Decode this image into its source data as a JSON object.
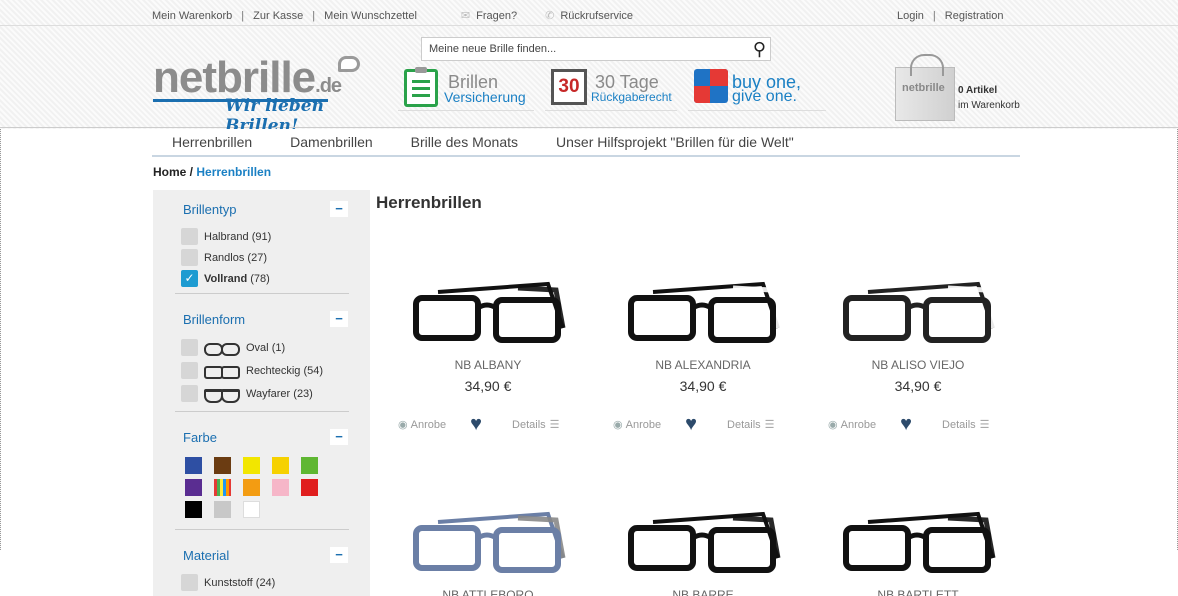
{
  "topbar": {
    "links": [
      "Mein Warenkorb",
      "Zur Kasse",
      "Mein Wunschzettel"
    ],
    "fragen": "Fragen?",
    "rueckruf": "Rückrufservice",
    "login": "Login",
    "registration": "Registration"
  },
  "logo": {
    "net": "net",
    "brille": "brille",
    "de": ".de",
    "tagline": "Wir lieben Brillen!"
  },
  "search": {
    "placeholder": "Meine neue Brille finden..."
  },
  "usps": [
    {
      "line1": "Brillen",
      "line2": "Versicherung"
    },
    {
      "badge": "30",
      "line1": "30 Tage",
      "line2": "Rückgaberecht"
    },
    {
      "line1": "buy one,",
      "line2": "give one."
    }
  ],
  "cart": {
    "bag_label": "netbrille",
    "count": "0 Artikel",
    "sub": "im Warenkorb"
  },
  "nav": [
    "Herrenbrillen",
    "Damenbrillen",
    "Brille des Monats",
    "Unser Hilfsprojekt \"Brillen für die Welt\""
  ],
  "breadcrumb": {
    "home": "Home",
    "sep": " / ",
    "current": "Herrenbrillen"
  },
  "filters": {
    "brillentyp": {
      "title": "Brillentyp",
      "items": [
        {
          "label": "Halbrand",
          "count": "(91)",
          "checked": false
        },
        {
          "label": "Randlos",
          "count": "(27)",
          "checked": false
        },
        {
          "label": "Vollrand",
          "count": "(78)",
          "checked": true
        }
      ]
    },
    "brillenform": {
      "title": "Brillenform",
      "items": [
        {
          "label": "Oval",
          "count": "(1)"
        },
        {
          "label": "Rechteckig",
          "count": "(54)"
        },
        {
          "label": "Wayfarer",
          "count": "(23)"
        }
      ]
    },
    "farbe": {
      "title": "Farbe",
      "colors": [
        "#2e4fa3",
        "#6b3c12",
        "#f2e600",
        "#f6d100",
        "#5fb732",
        "#5a2d91",
        "multi",
        "#f39c12",
        "#f6b6c8",
        "#e01e1e",
        "#000000",
        "#c8c8c8",
        "#ffffff"
      ]
    },
    "material": {
      "title": "Material",
      "items": [
        {
          "label": "Kunststoff",
          "count": "(24)"
        }
      ]
    }
  },
  "page_title": "Herrenbrillen",
  "products": [
    {
      "name": "NB ALBANY",
      "price": "34,90 €"
    },
    {
      "name": "NB ALEXANDRIA",
      "price": "34,90 €"
    },
    {
      "name": "NB ALISO VIEJO",
      "price": "34,90 €"
    },
    {
      "name": "NB ATTLEBORO",
      "price": ""
    },
    {
      "name": "NB BARRE",
      "price": ""
    },
    {
      "name": "NB BARTLETT",
      "price": ""
    }
  ],
  "product_actions": {
    "anrobe": "Anrobe",
    "details": "Details"
  }
}
